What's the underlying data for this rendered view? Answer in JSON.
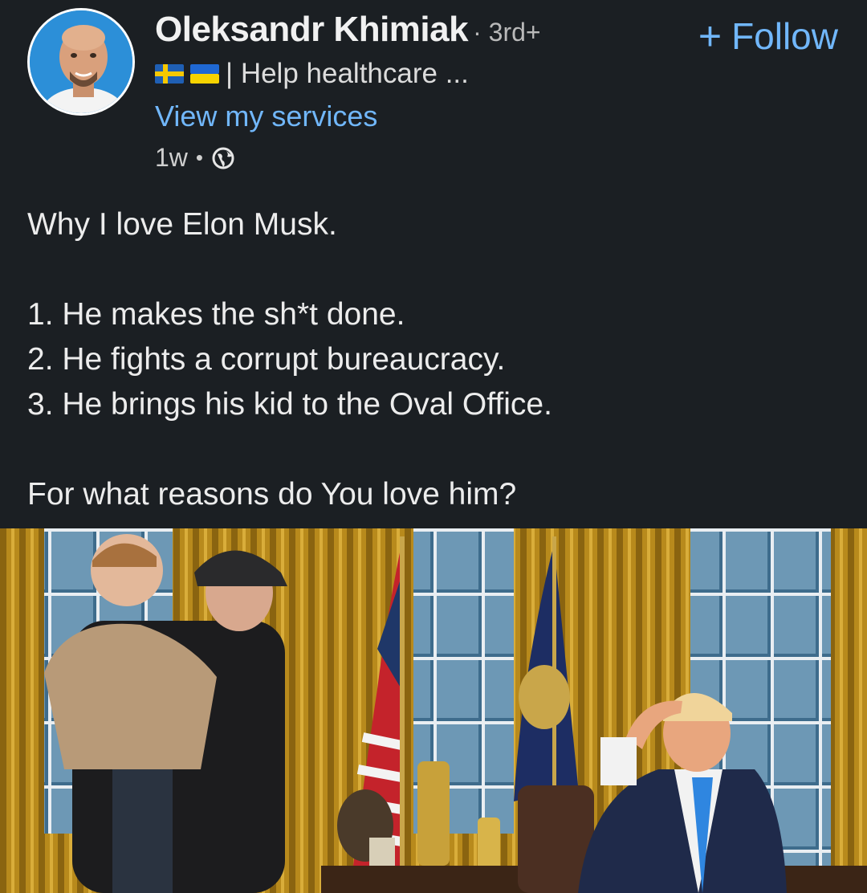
{
  "author": {
    "name": "Oleksandr Khimiak",
    "degree": "3rd+",
    "headline": "| Help healthcare ...",
    "services_link": "View my services",
    "time": "1w",
    "separator": "•",
    "flags": [
      "sweden-flag",
      "ukraine-flag"
    ]
  },
  "actions": {
    "follow_label": "Follow",
    "follow_plus": "+"
  },
  "post": {
    "lines": [
      "Why I love Elon Musk.",
      "1. He makes the sh*t done.",
      "2. He fights a corrupt bureaucracy.",
      "3. He brings his kid to the Oval Office.",
      "For what reasons do You love him?"
    ]
  },
  "colors": {
    "background": "#1b1f23",
    "link": "#71b7fb",
    "text": "#ececec"
  }
}
